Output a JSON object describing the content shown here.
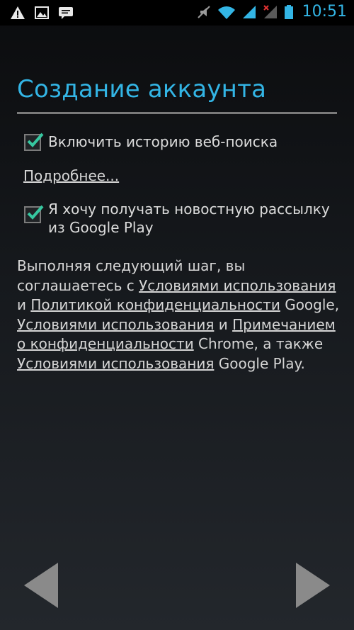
{
  "status_bar": {
    "time": "10:51",
    "left_icons": [
      "warning-icon",
      "image-icon",
      "message-icon"
    ],
    "right_icons": [
      "mute-icon",
      "wifi-icon",
      "signal-icon",
      "no-signal-icon",
      "battery-icon"
    ],
    "accent_color": "#33b5e5"
  },
  "header": {
    "title": "Создание аккаунта"
  },
  "options": {
    "web_history": {
      "label": "Включить историю веб-поиска",
      "checked": true
    },
    "more_link": "Подробнее...",
    "newsletter": {
      "label": "Я хочу получать новостную рассылку из Google Play",
      "checked": true
    }
  },
  "terms": {
    "t1": "Выполняя следующий шаг, вы соглашаетесь с ",
    "l1": "Условиями использования",
    "t2": " и ",
    "l2": "Политикой конфиденциальности",
    "t3": " Google, ",
    "l3": "Условиями использования",
    "t4": " и ",
    "l4": "Примечанием о конфиденциальности",
    "t5": " Chrome, а также ",
    "l5": "Условиями использования",
    "t6": " Google Play."
  },
  "navigation": {
    "back_icon": "arrow-left-icon",
    "next_icon": "arrow-right-icon"
  }
}
